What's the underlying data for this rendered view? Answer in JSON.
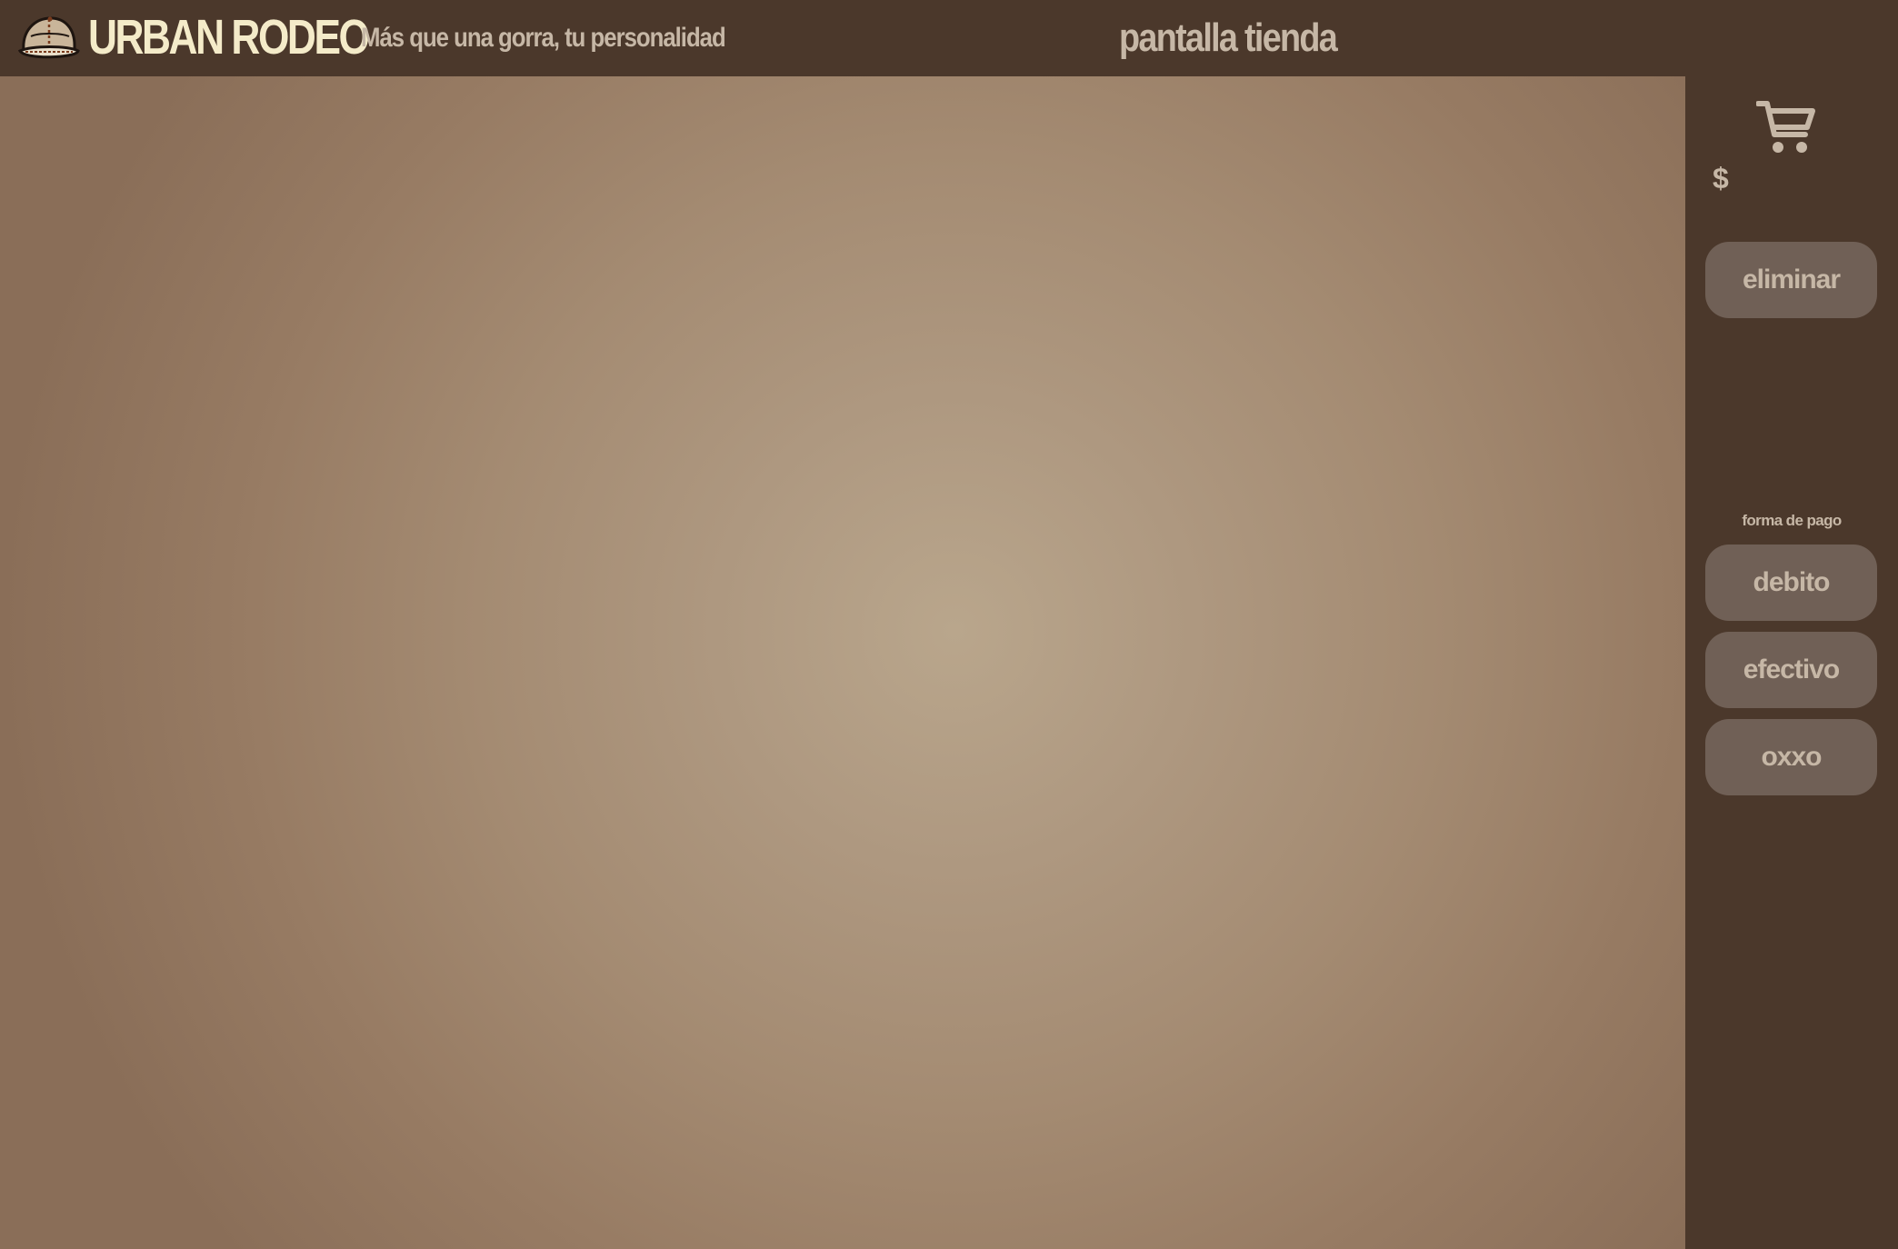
{
  "header": {
    "brand": "URBAN RODEO",
    "tagline": "Más que una gorra, tu personalidad",
    "screen_title": "pantalla tienda",
    "logo_icon": "cowboy-cap-icon"
  },
  "sidebar": {
    "cart_icon": "shopping-cart-icon",
    "total_label": "$",
    "delete_button": "eliminar",
    "payment_label": "forma de pago",
    "payment_options": [
      "debito",
      "efectivo",
      "oxxo"
    ]
  },
  "colors": {
    "header_bg": "#4b382b",
    "brand_text": "#f4ebc9",
    "muted_text": "#c6b7a6",
    "button_bg": "#706056",
    "content_center": "#b9a68c",
    "content_edge": "#8a6e58"
  }
}
